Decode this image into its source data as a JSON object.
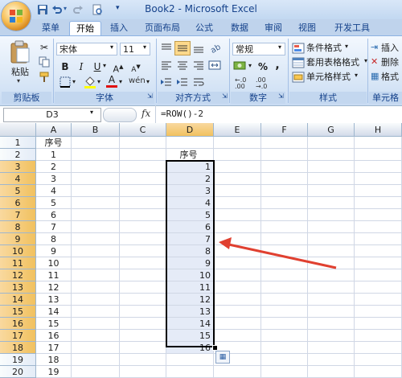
{
  "app": {
    "title": "Book2 - Microsoft Excel"
  },
  "tabs": [
    "菜单",
    "开始",
    "插入",
    "页面布局",
    "公式",
    "数据",
    "审阅",
    "视图",
    "开发工具"
  ],
  "active_tab": "开始",
  "ribbon": {
    "clipboard": {
      "paste_label": "粘贴",
      "group_label": "剪贴板"
    },
    "font": {
      "font_name": "宋体",
      "font_size": "11",
      "group_label": "字体"
    },
    "alignment": {
      "group_label": "对齐方式"
    },
    "number": {
      "format": "常规",
      "group_label": "数字",
      "percent": "%",
      "comma": ","
    },
    "styles": {
      "conditional": "条件格式",
      "table": "套用表格格式",
      "cell": "单元格样式",
      "group_label": "样式"
    },
    "cells": {
      "insert": "插入",
      "delete": "删除",
      "format": "格式",
      "group_label": "单元格"
    }
  },
  "formula_bar": {
    "name_box": "D3",
    "fx": "fx",
    "formula": "=ROW()-2"
  },
  "columns": [
    "A",
    "B",
    "C",
    "D",
    "E",
    "F",
    "G",
    "H"
  ],
  "selected_column": "D",
  "rows": [
    {
      "num": "1",
      "a": "序号",
      "d": ""
    },
    {
      "num": "2",
      "a": "1",
      "d": "序号"
    },
    {
      "num": "3",
      "a": "2",
      "d": "1"
    },
    {
      "num": "4",
      "a": "3",
      "d": "2"
    },
    {
      "num": "5",
      "a": "4",
      "d": "3"
    },
    {
      "num": "6",
      "a": "5",
      "d": "4"
    },
    {
      "num": "7",
      "a": "6",
      "d": "5"
    },
    {
      "num": "8",
      "a": "7",
      "d": "6"
    },
    {
      "num": "9",
      "a": "8",
      "d": "7"
    },
    {
      "num": "10",
      "a": "9",
      "d": "8"
    },
    {
      "num": "11",
      "a": "10",
      "d": "9"
    },
    {
      "num": "12",
      "a": "11",
      "d": "10"
    },
    {
      "num": "13",
      "a": "12",
      "d": "11"
    },
    {
      "num": "14",
      "a": "13",
      "d": "12"
    },
    {
      "num": "15",
      "a": "14",
      "d": "13"
    },
    {
      "num": "16",
      "a": "15",
      "d": "14"
    },
    {
      "num": "17",
      "a": "16",
      "d": "15"
    },
    {
      "num": "18",
      "a": "17",
      "d": "16"
    },
    {
      "num": "19",
      "a": "18",
      "d": ""
    },
    {
      "num": "20",
      "a": "19",
      "d": ""
    }
  ],
  "selected_rows": [
    "3",
    "4",
    "5",
    "6",
    "7",
    "8",
    "9",
    "10",
    "11",
    "12",
    "13",
    "14",
    "15",
    "16",
    "17",
    "18"
  ],
  "colors": {
    "accent": "#15428b",
    "selection_fill": "#e5ebf7",
    "row_header_sel": "#f1c15f",
    "arrow": "#e04030"
  }
}
